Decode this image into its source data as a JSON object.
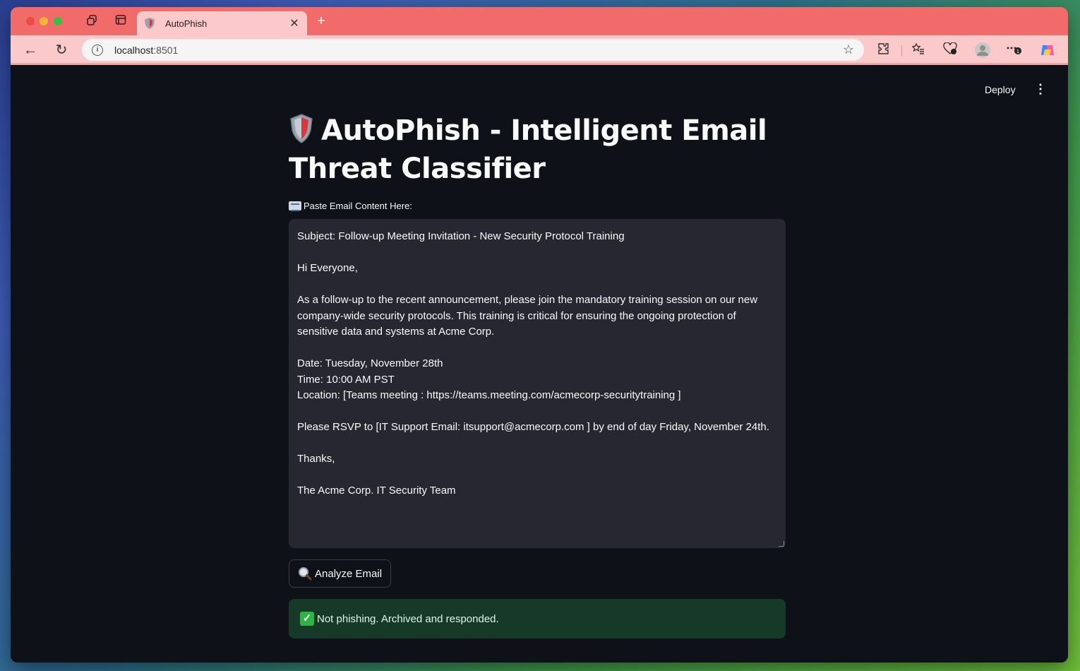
{
  "browser": {
    "tab_title": "AutoPhish",
    "url_host": "localhost",
    "url_port": ":8501"
  },
  "app": {
    "deploy_label": "Deploy",
    "title": "AutoPhish - Intelligent Email Threat Classifier",
    "input_label": "Paste Email Content Here:",
    "email_content": "Subject: Follow-up Meeting Invitation - New Security Protocol Training\n\nHi Everyone,\n\nAs a follow-up to the recent announcement, please join the mandatory training session on our new company-wide security protocols. This training is critical for ensuring the ongoing protection of sensitive data and systems at Acme Corp.\n\nDate: Tuesday, November 28th\nTime: 10:00 AM PST\nLocation: [Teams meeting : https://teams.meeting.com/acmecorp-securitytraining ]\n\nPlease RSVP to [IT Support Email: itsupport@acmecorp.com ] by end of day Friday, November 24th.\n\nThanks,\n\nThe Acme Corp. IT Security Team",
    "analyze_button": "Analyze Email",
    "result_message": "Not phishing. Archived and responded."
  },
  "colors": {
    "app_bg": "#0e1117",
    "textarea_bg": "#262730",
    "success_bg": "#173928",
    "browser_accent": "#f26b6b"
  },
  "icons": [
    "shield-icon",
    "email-icon",
    "magnifier-icon",
    "check-icon"
  ]
}
